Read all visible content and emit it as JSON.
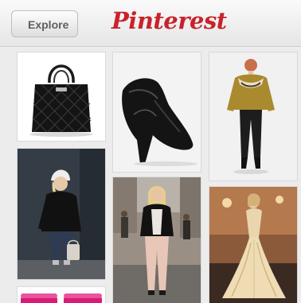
{
  "header": {
    "back_label": "Explore",
    "logo_text": "Pinterest"
  },
  "colors": {
    "brand_red": "#c8232c",
    "header_bg": "#e9e9e9",
    "feed_bg": "#ececec"
  },
  "pins": [
    {
      "subject": "black quilted handbag",
      "icon": "handbag-image"
    },
    {
      "subject": "black leather wedge bootie",
      "icon": "bootie-image"
    },
    {
      "subject": "model in mustard fair-isle sweater",
      "icon": "sweater-model-image"
    },
    {
      "subject": "street style woman in white beanie",
      "icon": "street-style-image"
    },
    {
      "subject": "blonde woman on city street",
      "icon": "city-street-image"
    },
    {
      "subject": "gold gown on runway",
      "icon": "runway-gown-image"
    },
    {
      "subject": "pink accessories",
      "icon": "pink-accessories-image"
    }
  ]
}
